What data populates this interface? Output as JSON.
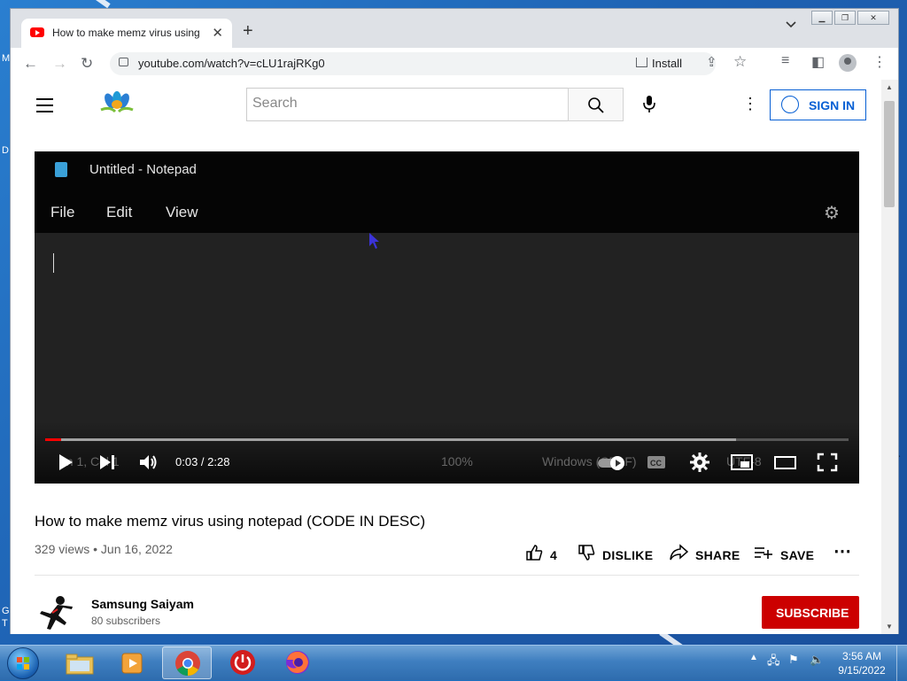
{
  "desktop": {
    "edge_labels": [
      "M",
      "D",
      "G",
      "T"
    ]
  },
  "browser": {
    "tab_title": "How to make memz virus using n",
    "url": "youtube.com/watch?v=cLU1rajRKg0",
    "install_label": "Install"
  },
  "youtube": {
    "search_placeholder": "Search",
    "signin_label": "SIGN IN"
  },
  "video": {
    "notepad_title": "Untitled - Notepad",
    "notepad_menu": [
      "File",
      "Edit",
      "View"
    ],
    "status_ghost": [
      "Ln 1, Col 1",
      "100%",
      "Windows (CRLF)",
      "UTF-8"
    ],
    "current_time": "0:03 / 2:28",
    "progress_played": 0.02,
    "progress_buffered": 0.86
  },
  "details": {
    "title": "How to make memz virus using notepad (CODE IN DESC)",
    "meta": "329 views • Jun 16, 2022",
    "likes": "4",
    "dislike_label": "DISLIKE",
    "share_label": "SHARE",
    "save_label": "SAVE",
    "channel_name": "Samsung Saiyam",
    "subscribers": "80 subscribers",
    "subscribe_label": "SUBSCRIBE"
  },
  "taskbar": {
    "time": "3:56 AM",
    "date": "9/15/2022"
  },
  "colors": {
    "youtube_red": "#cc0000",
    "link_blue": "#065fd4",
    "progress_red": "#ff0000"
  }
}
